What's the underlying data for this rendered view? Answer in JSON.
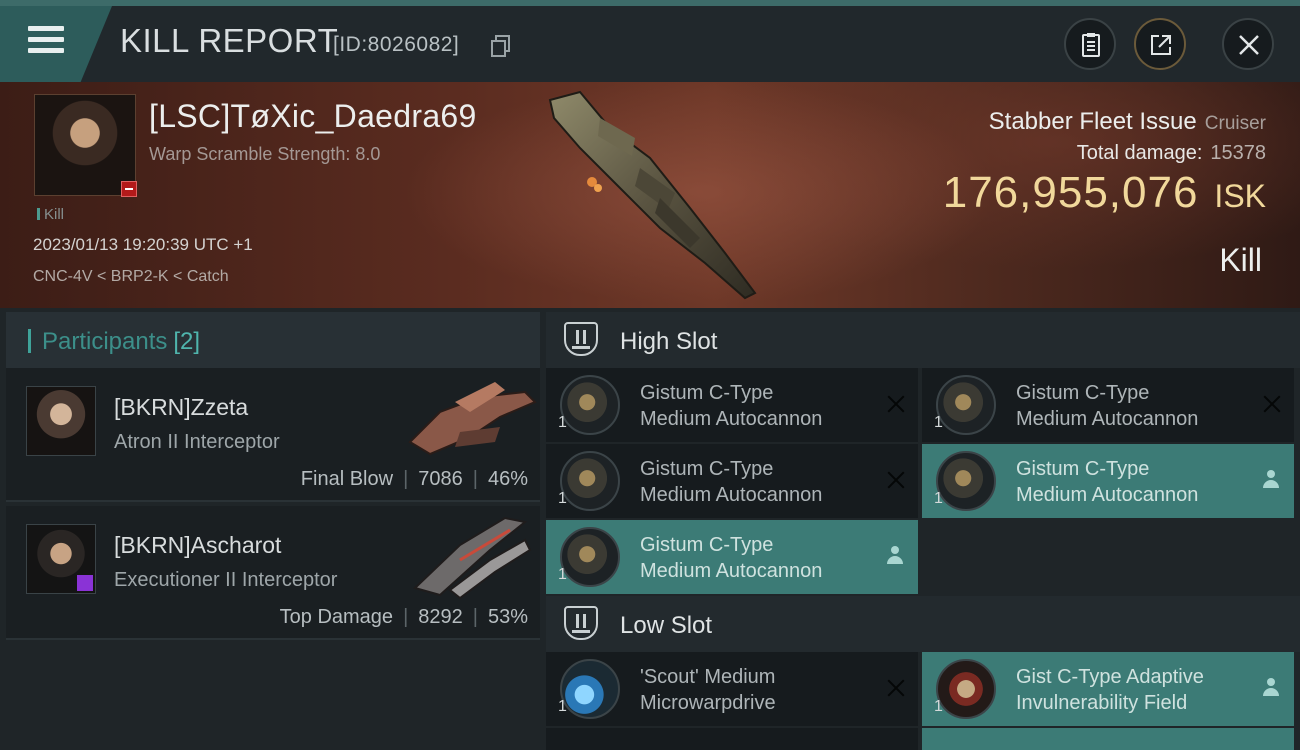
{
  "header": {
    "title": "KILL REPORT",
    "id_label": "[ID:8026082]",
    "icons": [
      "menu-icon",
      "copy-icon",
      "clipboard-icon",
      "share-icon",
      "close-icon"
    ]
  },
  "victim": {
    "name": "[LSC]TøXic_Daedra69",
    "warp_scramble": "Warp Scramble Strength: 8.0",
    "tag": "Kill",
    "datetime": "2023/01/13 19:20:39 UTC +1",
    "location": "CNC-4V < BRP2-K < Catch",
    "ship_name": "Stabber Fleet Issue",
    "ship_class": "Cruiser",
    "total_damage_label": "Total damage:",
    "total_damage": "15378",
    "isk_value": "176,955,076",
    "isk_unit": "ISK",
    "result": "Kill"
  },
  "participants": {
    "title": "Participants",
    "count": "[2]",
    "rows": [
      {
        "name": "[BKRN]Zzeta",
        "ship": "Atron II Interceptor",
        "role": "Final Blow",
        "damage": "7086",
        "percent": "46%"
      },
      {
        "name": "[BKRN]Ascharot",
        "ship": "Executioner II Interceptor",
        "role": "Top Damage",
        "damage": "8292",
        "percent": "53%"
      }
    ]
  },
  "slots": {
    "high": {
      "title": "High Slot",
      "modules": [
        {
          "line1": "Gistum C-Type",
          "line2": "Medium Autocannon",
          "qty": "1",
          "state": "destroyed"
        },
        {
          "line1": "Gistum C-Type",
          "line2": "Medium Autocannon",
          "qty": "1",
          "state": "destroyed"
        },
        {
          "line1": "Gistum C-Type",
          "line2": "Medium Autocannon",
          "qty": "1",
          "state": "destroyed"
        },
        {
          "line1": "Gistum C-Type",
          "line2": "Medium Autocannon",
          "qty": "1",
          "state": "dropped"
        },
        {
          "line1": "Gistum C-Type",
          "line2": "Medium Autocannon",
          "qty": "1",
          "state": "dropped"
        }
      ]
    },
    "low": {
      "title": "Low Slot",
      "modules": [
        {
          "line1": "'Scout' Medium",
          "line2": "Microwarpdrive",
          "qty": "1",
          "state": "destroyed"
        },
        {
          "line1": "Gist C-Type Adaptive",
          "line2": "Invulnerability Field",
          "qty": "1",
          "state": "dropped"
        }
      ]
    }
  },
  "colors": {
    "accent_teal": "#3c7b76",
    "isk_gold": "#f1d89b",
    "banner_red": "#5b2c20"
  }
}
